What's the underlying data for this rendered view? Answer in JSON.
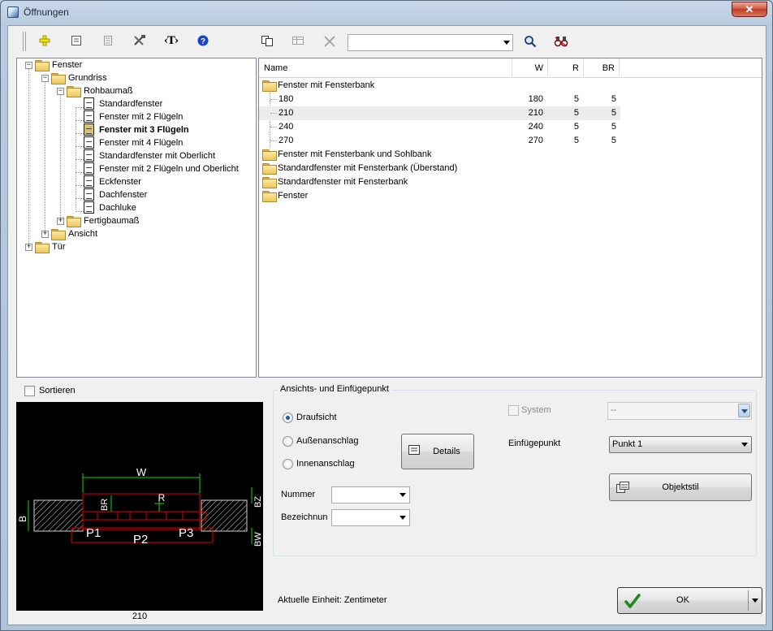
{
  "window": {
    "title": "Öffnungen",
    "close_label": "✕"
  },
  "toolbar": {
    "items": [
      "add-icon",
      "properties-icon",
      "list-icon",
      "tools-icon",
      "text-tag-icon",
      "help-icon",
      "copy-icon",
      "table-icon",
      "delete-icon",
      "search-icon",
      "binoculars-icon"
    ],
    "text_tag_label": "‹T›",
    "search_value": ""
  },
  "tree": {
    "fenster": "Fenster",
    "grundriss": "Grundriss",
    "rohbaumass": "Rohbaumaß",
    "items": [
      "Standardfenster",
      "Fenster mit 2 Flügeln",
      "Fenster mit 3 Flügeln",
      "Fenster mit 4 Flügeln",
      "Standardfenster mit Oberlicht",
      "Fenster mit 2 Flügeln und Oberlicht",
      "Eckfenster",
      "Dachfenster",
      "Dachluke"
    ],
    "selected": "Fenster mit 3 Flügeln",
    "fertigbaumass": "Fertigbaumaß",
    "ansicht": "Ansicht",
    "tuer": "Tür"
  },
  "list": {
    "columns": {
      "name": "Name",
      "w": "W",
      "r": "R",
      "br": "BR"
    },
    "open_folder": "Fenster mit Fensterbank",
    "rows": [
      {
        "name": "180",
        "w": "180",
        "r": "5",
        "br": "5"
      },
      {
        "name": "210",
        "w": "210",
        "r": "5",
        "br": "5"
      },
      {
        "name": "240",
        "w": "240",
        "r": "5",
        "br": "5"
      },
      {
        "name": "270",
        "w": "270",
        "r": "5",
        "br": "5"
      }
    ],
    "folders": [
      "Fenster mit Fensterbank und Sohlbank",
      "Standardfenster mit Fensterbank (Überstand)",
      "Standardfenster mit Fensterbank",
      "Fenster"
    ]
  },
  "sort": {
    "label": "Sortieren",
    "checked": false
  },
  "preview": {
    "caption": "210",
    "labels": {
      "w": "W",
      "r": "R",
      "br": "BR",
      "b": "B",
      "bz": "BZ",
      "bw": "BW",
      "p1": "P1",
      "p2": "P2",
      "p3": "P3"
    },
    "colors": {
      "background": "#000000",
      "lines": "#ffffff",
      "dims": "#00ff00",
      "frame": "#ff0000",
      "hatch": "#d0d0d0"
    }
  },
  "group": {
    "title": "Ansichts- und Einfügepunkt",
    "radios": [
      "Draufsicht",
      "Außenanschlag",
      "Innenanschlag"
    ],
    "selected_radio": "Draufsicht",
    "details_label": "Details",
    "nummer_label": "Nummer",
    "nummer_value": "",
    "bezeichnung_label": "Bezeichnun",
    "bezeichnung_value": "",
    "system_label": "System",
    "system_value": "--",
    "einfuegepunkt_label": "Einfügepunkt",
    "einfuegepunkt_value": "Punkt 1",
    "objektstil_label": "Objektstil"
  },
  "footer": {
    "unit_text": "Aktuelle Einheit: Zentimeter",
    "ok_label": "OK"
  }
}
